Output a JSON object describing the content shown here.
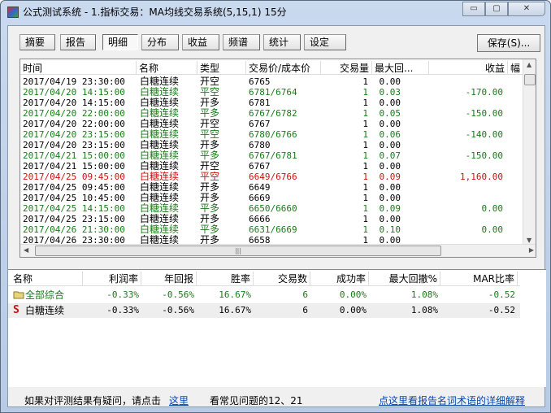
{
  "window": {
    "title": "公式测试系统 - 1.指标交易：MA均线交易系统(5,15,1) 15分",
    "controls": [
      "▭",
      "▢",
      "✕"
    ]
  },
  "tabs": [
    {
      "label": "摘要"
    },
    {
      "label": "报告"
    },
    {
      "label": "明细",
      "active": true
    },
    {
      "label": "分布"
    },
    {
      "label": "收益"
    },
    {
      "label": "频谱"
    },
    {
      "label": "统计"
    },
    {
      "label": "设定"
    }
  ],
  "save_label": "保存(S)...",
  "detail": {
    "columns": [
      "时间",
      "名称",
      "类型",
      "交易价/成本价",
      "交易量",
      "最大回...",
      "收益",
      "幅"
    ],
    "rows": [
      {
        "time": "2017/04/19 23:30:00",
        "name": "白糖连续",
        "type": "开空",
        "price": "6765",
        "qty": "1",
        "dd": "0.00",
        "profit": "",
        "color": "k"
      },
      {
        "time": "2017/04/20 14:15:00",
        "name": "白糖连续",
        "type": "平空",
        "price": "6781/6764",
        "qty": "1",
        "dd": "0.03",
        "profit": "-170.00",
        "color": "g"
      },
      {
        "time": "2017/04/20 14:15:00",
        "name": "白糖连续",
        "type": "开多",
        "price": "6781",
        "qty": "1",
        "dd": "0.00",
        "profit": "",
        "color": "k"
      },
      {
        "time": "2017/04/20 22:00:00",
        "name": "白糖连续",
        "type": "平多",
        "price": "6767/6782",
        "qty": "1",
        "dd": "0.05",
        "profit": "-150.00",
        "color": "g"
      },
      {
        "time": "2017/04/20 22:00:00",
        "name": "白糖连续",
        "type": "开空",
        "price": "6767",
        "qty": "1",
        "dd": "0.00",
        "profit": "",
        "color": "k"
      },
      {
        "time": "2017/04/20 23:15:00",
        "name": "白糖连续",
        "type": "平空",
        "price": "6780/6766",
        "qty": "1",
        "dd": "0.06",
        "profit": "-140.00",
        "color": "g"
      },
      {
        "time": "2017/04/20 23:15:00",
        "name": "白糖连续",
        "type": "开多",
        "price": "6780",
        "qty": "1",
        "dd": "0.00",
        "profit": "",
        "color": "k"
      },
      {
        "time": "2017/04/21 15:00:00",
        "name": "白糖连续",
        "type": "平多",
        "price": "6767/6781",
        "qty": "1",
        "dd": "0.07",
        "profit": "-150.00",
        "color": "g"
      },
      {
        "time": "2017/04/21 15:00:00",
        "name": "白糖连续",
        "type": "开空",
        "price": "6767",
        "qty": "1",
        "dd": "0.00",
        "profit": "",
        "color": "k"
      },
      {
        "time": "2017/04/25 09:45:00",
        "name": "白糖连续",
        "type": "平空",
        "price": "6649/6766",
        "qty": "1",
        "dd": "0.09",
        "profit": "1,160.00",
        "color": "red"
      },
      {
        "time": "2017/04/25 09:45:00",
        "name": "白糖连续",
        "type": "开多",
        "price": "6649",
        "qty": "1",
        "dd": "0.00",
        "profit": "",
        "color": "k"
      },
      {
        "time": "2017/04/25 10:45:00",
        "name": "白糖连续",
        "type": "开多",
        "price": "6669",
        "qty": "1",
        "dd": "0.00",
        "profit": "",
        "color": "k"
      },
      {
        "time": "2017/04/25 14:15:00",
        "name": "白糖连续",
        "type": "平多",
        "price": "6650/6660",
        "qty": "1",
        "dd": "0.09",
        "profit": "0.00",
        "color": "g"
      },
      {
        "time": "2017/04/25 23:15:00",
        "name": "白糖连续",
        "type": "开多",
        "price": "6666",
        "qty": "1",
        "dd": "0.00",
        "profit": "",
        "color": "k"
      },
      {
        "time": "2017/04/26 21:30:00",
        "name": "白糖连续",
        "type": "平多",
        "price": "6631/6669",
        "qty": "1",
        "dd": "0.10",
        "profit": "0.00",
        "color": "g"
      },
      {
        "time": "2017/04/26 23:30:00",
        "name": "白糖连续",
        "type": "开多",
        "price": "6658",
        "qty": "1",
        "dd": "0.00",
        "profit": "",
        "color": "k"
      }
    ]
  },
  "summary": {
    "columns": [
      "名称",
      "利润率",
      "年回报",
      "胜率",
      "交易数",
      "成功率",
      "最大回撤%",
      "MAR比率"
    ],
    "rows": [
      {
        "icon": "folder-icon",
        "values": [
          "全部综合",
          "-0.33%",
          "-0.56%",
          "16.67%",
          "6",
          "0.00%",
          "1.08%",
          "-0.52"
        ],
        "color": "g"
      },
      {
        "icon": "S",
        "values": [
          "白糖连续",
          "-0.33%",
          "-0.56%",
          "16.67%",
          "6",
          "0.00%",
          "1.08%",
          "-0.52"
        ],
        "color": "k"
      }
    ]
  },
  "footer": {
    "text1": "如果对评测结果有疑问，请点击",
    "link1": "这里",
    "text2": "看常见问题的12、21",
    "link2": "点这里看报告名词术语的详细解释"
  }
}
